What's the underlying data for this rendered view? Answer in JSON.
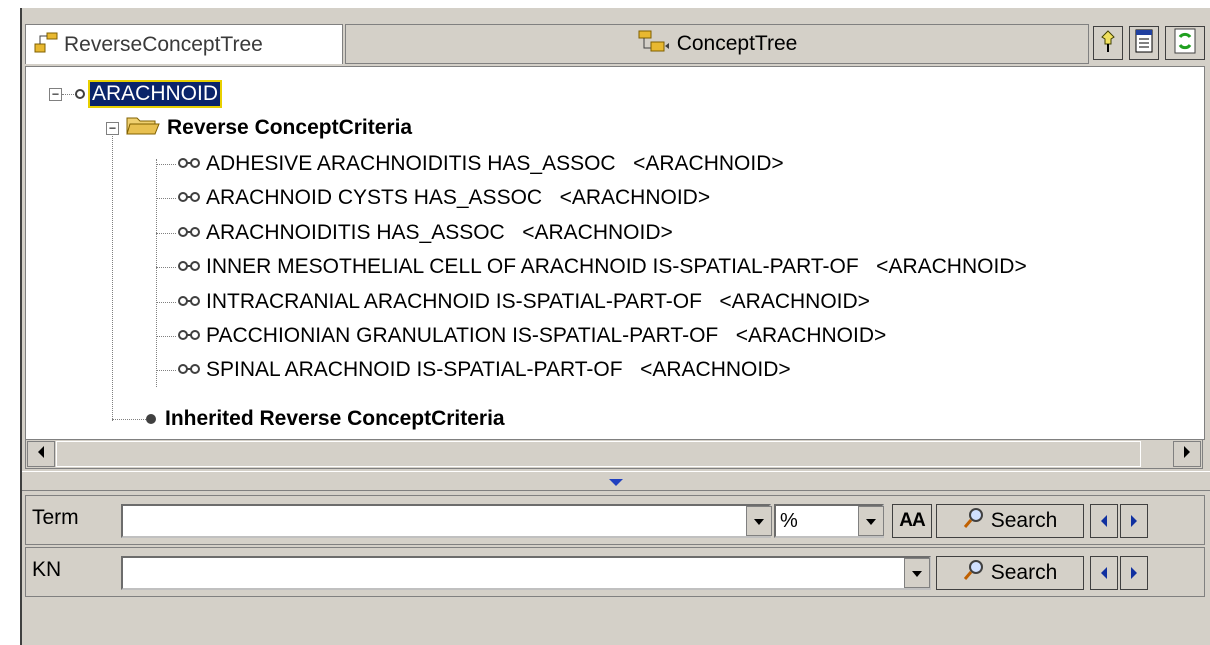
{
  "tabs": [
    {
      "label": "ReverseConceptTree",
      "icon": "tree-icon",
      "active": true
    },
    {
      "label": "ConceptTree",
      "icon": "tree-icon",
      "active": false
    }
  ],
  "toolbar": {
    "icons": [
      "pin-icon",
      "document-icon",
      "refresh-icon"
    ]
  },
  "tree": {
    "root": {
      "label": "ARACHNOID",
      "selected": true
    },
    "folder": {
      "label": "Reverse ConceptCriteria",
      "icon": "folder-icon"
    },
    "criteria": [
      "ADHESIVE ARACHNOIDITIS HAS_ASSOC   <ARACHNOID>",
      "ARACHNOID CYSTS HAS_ASSOC   <ARACHNOID>",
      "ARACHNOIDITIS HAS_ASSOC   <ARACHNOID>",
      "INNER MESOTHELIAL CELL OF ARACHNOID IS-SPATIAL-PART-OF   <ARACHNOID>",
      "INTRACRANIAL ARACHNOID IS-SPATIAL-PART-OF   <ARACHNOID>",
      "PACCHIONIAN GRANULATION IS-SPATIAL-PART-OF   <ARACHNOID>",
      "SPINAL ARACHNOID IS-SPATIAL-PART-OF   <ARACHNOID>"
    ],
    "inherited": {
      "label": "Inherited Reverse ConceptCriteria"
    }
  },
  "search_term": {
    "label": "Term",
    "value": "",
    "match_value": "%",
    "case_button": "AA",
    "search_label": "Search"
  },
  "search_kn": {
    "label": "KN",
    "value": "",
    "search_label": "Search"
  },
  "colors": {
    "selection": "#0a246a",
    "panel": "#d4d0c8",
    "focus_outline": "#e8d000"
  }
}
